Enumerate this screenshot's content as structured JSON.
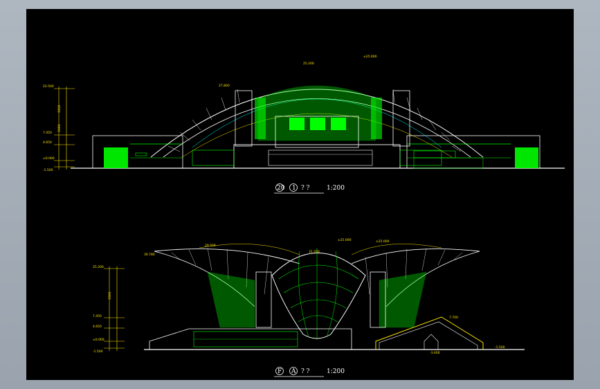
{
  "colors": {
    "frame": "#a3abb5",
    "canvas": "#000000",
    "structure": "#00ff00",
    "outline": "#ffffff",
    "dimension": "#ffe600",
    "annotation": "#00ffff"
  },
  "top_elevation": {
    "title_number": "20",
    "title_axis": "1",
    "title_rest": "? ?",
    "scale": "1:200",
    "elevations": [
      {
        "label": "22.500"
      },
      {
        "label": "7.450"
      },
      {
        "label": "4.650"
      },
      {
        "label": "±0.000"
      },
      {
        "label": "-1.500"
      }
    ],
    "roof_labels": [
      "25.200",
      "27.800",
      "±25.000"
    ],
    "dim_labels": [
      "3150",
      "3300"
    ]
  },
  "bottom_elevation": {
    "title_number": "F",
    "title_axis": "A",
    "title_rest": "? ?",
    "scale": "1:200",
    "elevations": [
      {
        "label": "25.200"
      },
      {
        "label": "7.450"
      },
      {
        "label": "4.650"
      },
      {
        "label": "±0.000"
      },
      {
        "label": "-1.500"
      }
    ],
    "roof_labels": [
      "29.500",
      "30.780",
      "31.700",
      "±25.000",
      "±25.000",
      "7.700",
      "-1.500",
      "-3.400"
    ],
    "dim_labels": [
      "3300"
    ]
  }
}
